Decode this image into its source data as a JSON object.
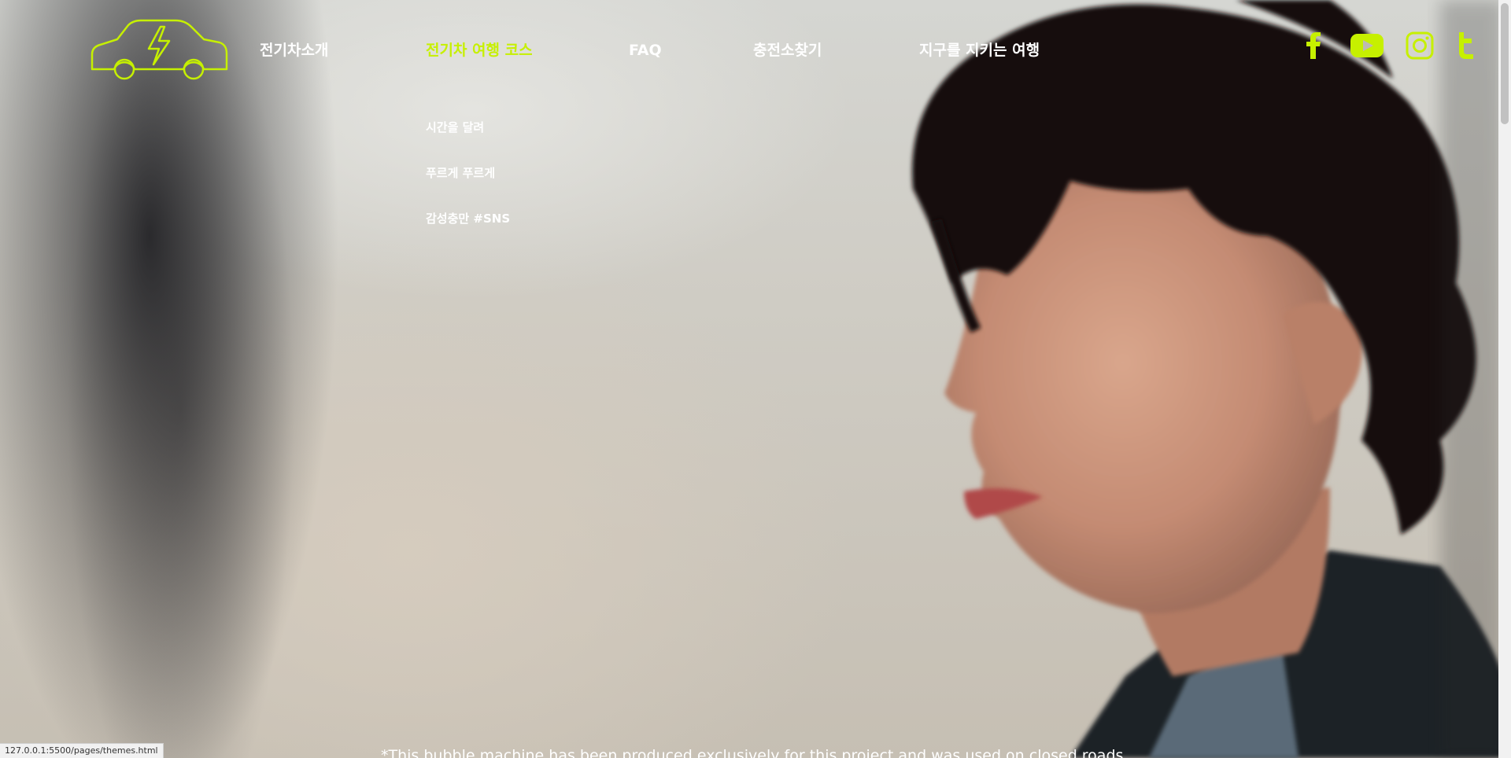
{
  "nav": {
    "items": [
      {
        "label": "전기차소개"
      },
      {
        "label": "전기차 여행 코스"
      },
      {
        "label": "FAQ"
      },
      {
        "label": "충전소찾기"
      },
      {
        "label": "지구를 지키는 여행"
      }
    ],
    "active_index": 1,
    "sub_menu": [
      {
        "label": "시간을 달려"
      },
      {
        "label": "푸르게 푸르게"
      },
      {
        "label": "감성충만 #SNS"
      }
    ]
  },
  "sns": [
    {
      "icon": "facebook-icon"
    },
    {
      "icon": "youtube-icon"
    },
    {
      "icon": "instagram-icon"
    },
    {
      "icon": "twitter-icon"
    }
  ],
  "hero": {
    "caption": "*This bubble machine has been produced exclusively for this project and was used on closed roads."
  },
  "status_bar": {
    "url": "127.0.0.1:5500/pages/themes.html"
  },
  "colors": {
    "accent": "#c6f000",
    "nav_text": "#ffffff"
  }
}
